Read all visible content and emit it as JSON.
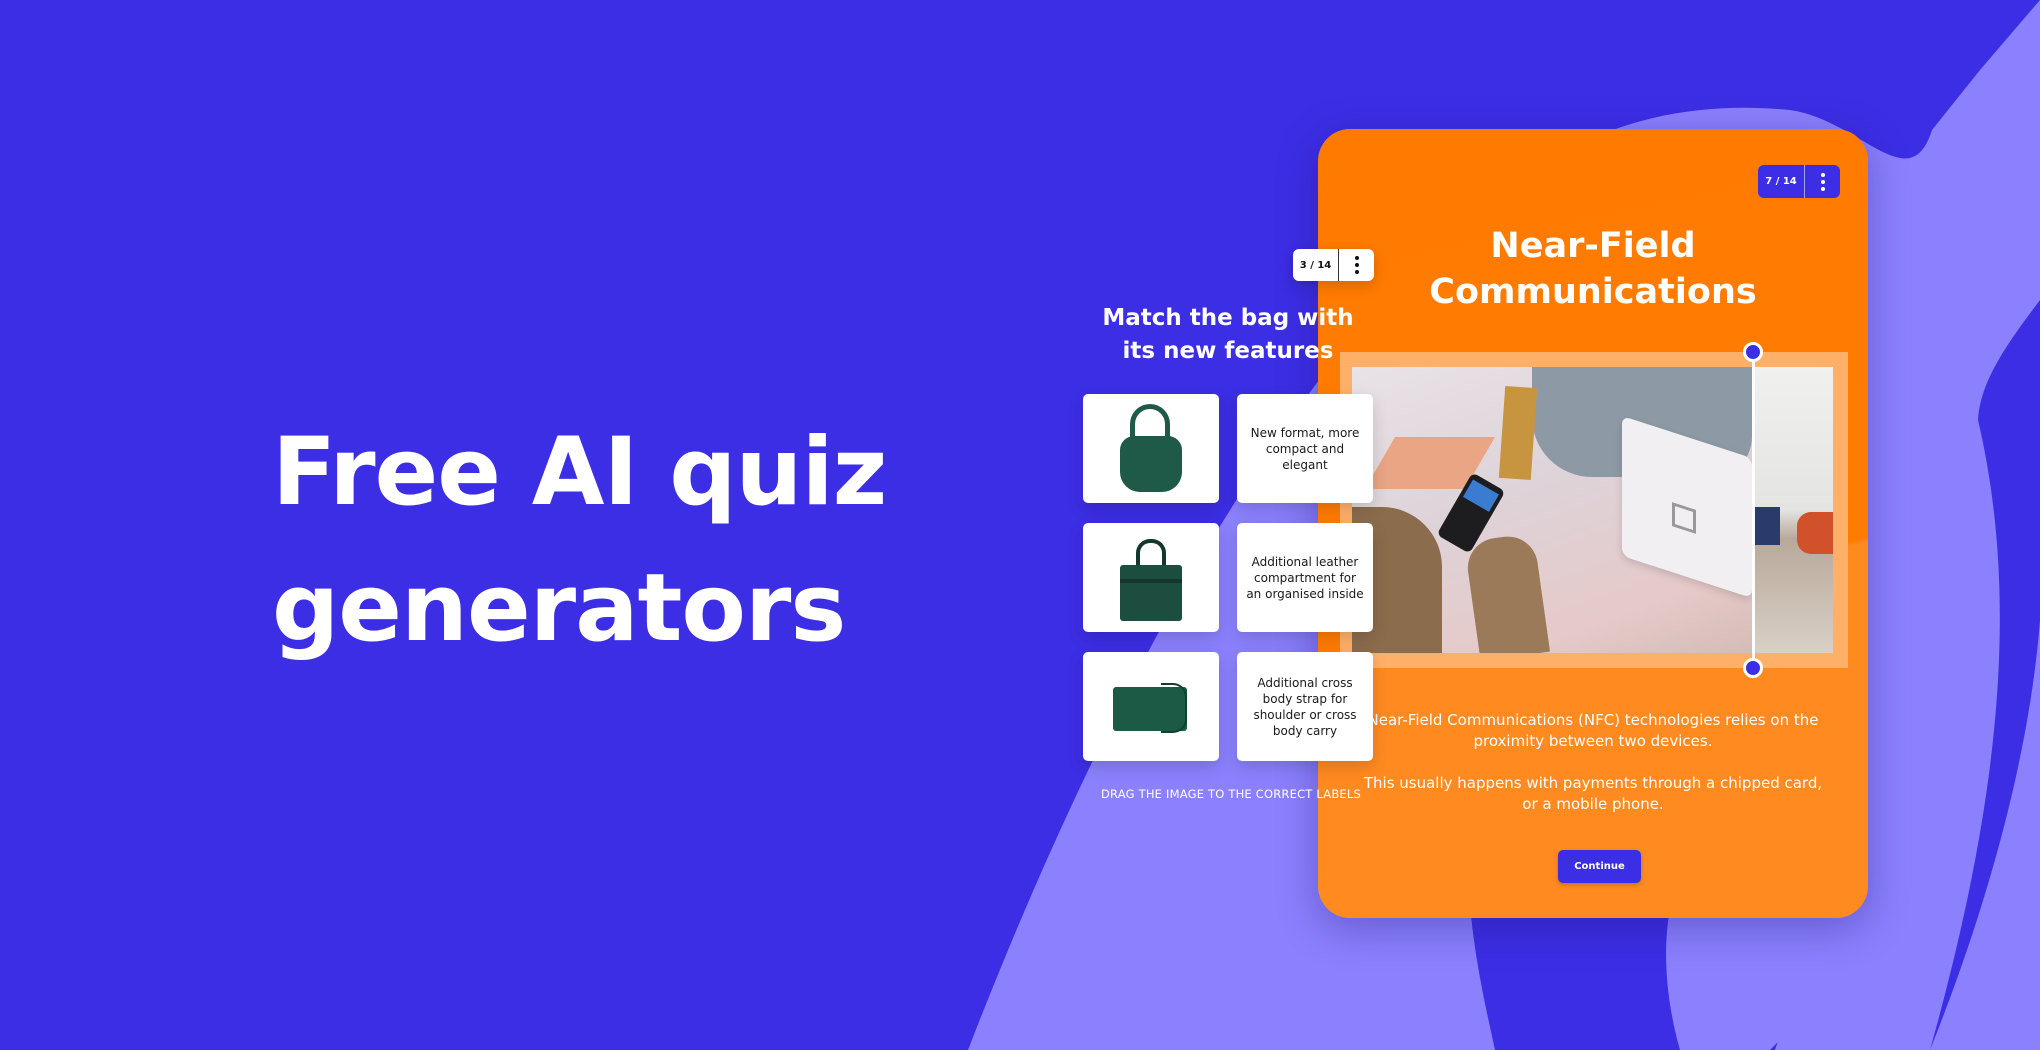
{
  "hero": {
    "headline_line1": "Free AI quiz",
    "headline_line2": "generators"
  },
  "colors": {
    "background": "#3c2ee4",
    "swoosh": "#8b80fd",
    "card_orange": "#ff7a00",
    "frame": "#ffb068",
    "accent": "#3c2ee4"
  },
  "main_quiz": {
    "counter": "7 / 14",
    "menu_icon": "more-vertical-icon",
    "title_line1": "Near-Field",
    "title_line2": "Communications",
    "image_description": "Customer paying with a mobile phone at a contactless card terminal",
    "body_paragraph1": "Near-Field Communications (NFC) technologies relies on the proximity between two devices.",
    "body_paragraph2": "This usually happens with payments through a chipped card, or a mobile phone.",
    "continue_label": "Continue"
  },
  "match_quiz": {
    "counter": "3 / 14",
    "menu_icon": "more-vertical-icon",
    "title_line1": "Match the bag with",
    "title_line2": "its new features",
    "items": [
      {
        "image": "green hobo shoulder bag",
        "label": "New format, more compact and elegant"
      },
      {
        "image": "green tote handbag",
        "label": "Additional leather compartment for an organised inside"
      },
      {
        "image": "green crossbody clutch",
        "label": "Additional cross body strap for shoulder or cross body carry"
      }
    ],
    "instruction": "DRAG THE IMAGE TO THE CORRECT LABELS"
  }
}
